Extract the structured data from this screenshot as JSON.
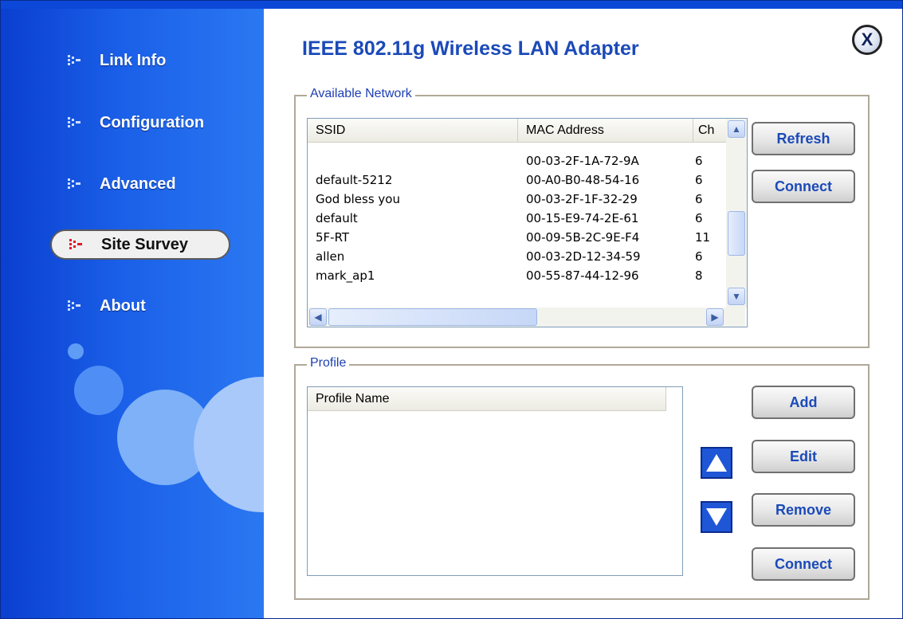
{
  "app": {
    "title": "IEEE 802.11g Wireless LAN Adapter",
    "close_label": "X"
  },
  "sidebar": {
    "items": [
      {
        "label": "Link Info"
      },
      {
        "label": "Configuration"
      },
      {
        "label": "Advanced"
      },
      {
        "label": "Site Survey"
      },
      {
        "label": "About"
      }
    ]
  },
  "available_network": {
    "group_label": "Available Network",
    "columns": [
      "SSID",
      "MAC Address",
      "Ch"
    ],
    "rows": [
      {
        "ssid": "",
        "mac": "00-03-2F-1A-72-9A",
        "ch": "6"
      },
      {
        "ssid": "default-5212",
        "mac": "00-A0-B0-48-54-16",
        "ch": "6"
      },
      {
        "ssid": "God bless you",
        "mac": "00-03-2F-1F-32-29",
        "ch": "6"
      },
      {
        "ssid": "default",
        "mac": "00-15-E9-74-2E-61",
        "ch": "6"
      },
      {
        "ssid": "5F-RT",
        "mac": "00-09-5B-2C-9E-F4",
        "ch": "11"
      },
      {
        "ssid": "allen",
        "mac": "00-03-2D-12-34-59",
        "ch": "6"
      },
      {
        "ssid": "mark_ap1",
        "mac": "00-55-87-44-12-96",
        "ch": "8"
      }
    ],
    "buttons": {
      "refresh": "Refresh",
      "connect": "Connect"
    }
  },
  "profile": {
    "group_label": "Profile",
    "columns": [
      "Profile Name"
    ],
    "buttons": {
      "add": "Add",
      "edit": "Edit",
      "remove": "Remove",
      "connect": "Connect"
    }
  },
  "icons": {
    "nav": "dots-arrow-icon",
    "close": "close-icon",
    "up": "move-up-icon",
    "down": "move-down-icon"
  },
  "colors": {
    "accent": "#1b4ab8",
    "sidebar": "#1a5fe8",
    "active_icon": "#e0182b"
  }
}
